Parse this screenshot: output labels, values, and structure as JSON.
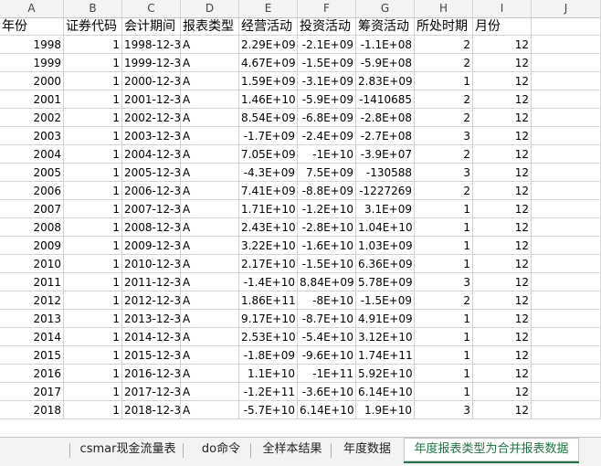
{
  "columns": [
    "A",
    "B",
    "C",
    "D",
    "E",
    "F",
    "G",
    "H",
    "I",
    "J"
  ],
  "headers": [
    "年份",
    "证券代码",
    "会计期间",
    "报表类型",
    "经营活动",
    "投资活动",
    "筹资活动",
    "所处时期",
    "月份",
    ""
  ],
  "rows": [
    [
      "1998",
      "1",
      "1998-12-3",
      "A",
      "2.29E+09",
      "-2.1E+09",
      "-1.1E+08",
      "2",
      "12"
    ],
    [
      "1999",
      "1",
      "1999-12-3",
      "A",
      "4.67E+09",
      "-1.5E+09",
      "-5.9E+08",
      "2",
      "12"
    ],
    [
      "2000",
      "1",
      "2000-12-3",
      "A",
      "1.59E+09",
      "-3.1E+09",
      "2.83E+09",
      "1",
      "12"
    ],
    [
      "2001",
      "1",
      "2001-12-3",
      "A",
      "1.46E+10",
      "-5.9E+09",
      "-1410685",
      "2",
      "12"
    ],
    [
      "2002",
      "1",
      "2002-12-3",
      "A",
      "8.54E+09",
      "-6.8E+09",
      "-2.8E+08",
      "2",
      "12"
    ],
    [
      "2003",
      "1",
      "2003-12-3",
      "A",
      "-1.7E+09",
      "-2.4E+09",
      "-2.7E+08",
      "3",
      "12"
    ],
    [
      "2004",
      "1",
      "2004-12-3",
      "A",
      "7.05E+09",
      "-1E+10",
      "-3.9E+07",
      "2",
      "12"
    ],
    [
      "2005",
      "1",
      "2005-12-3",
      "A",
      "-4.3E+09",
      "7.5E+09",
      "-130588",
      "3",
      "12"
    ],
    [
      "2006",
      "1",
      "2006-12-3",
      "A",
      "7.41E+09",
      "-8.8E+09",
      "-1227269",
      "2",
      "12"
    ],
    [
      "2007",
      "1",
      "2007-12-3",
      "A",
      "1.71E+10",
      "-1.2E+10",
      "3.1E+09",
      "1",
      "12"
    ],
    [
      "2008",
      "1",
      "2008-12-3",
      "A",
      "2.43E+10",
      "-2.8E+10",
      "1.04E+10",
      "1",
      "12"
    ],
    [
      "2009",
      "1",
      "2009-12-3",
      "A",
      "3.22E+10",
      "-1.6E+10",
      "1.03E+09",
      "1",
      "12"
    ],
    [
      "2010",
      "1",
      "2010-12-3",
      "A",
      "2.17E+10",
      "-1.5E+10",
      "6.36E+09",
      "1",
      "12"
    ],
    [
      "2011",
      "1",
      "2011-12-3",
      "A",
      "-1.4E+10",
      "8.84E+09",
      "5.78E+09",
      "3",
      "12"
    ],
    [
      "2012",
      "1",
      "2012-12-3",
      "A",
      "1.86E+11",
      "-8E+10",
      "-1.5E+09",
      "2",
      "12"
    ],
    [
      "2013",
      "1",
      "2013-12-3",
      "A",
      "9.17E+10",
      "-8.7E+10",
      "4.91E+09",
      "1",
      "12"
    ],
    [
      "2014",
      "1",
      "2014-12-3",
      "A",
      "2.53E+10",
      "-5.4E+10",
      "3.12E+10",
      "1",
      "12"
    ],
    [
      "2015",
      "1",
      "2015-12-3",
      "A",
      "-1.8E+09",
      "-9.6E+10",
      "1.74E+11",
      "1",
      "12"
    ],
    [
      "2016",
      "1",
      "2016-12-3",
      "A",
      "1.1E+10",
      "-1E+11",
      "5.92E+10",
      "1",
      "12"
    ],
    [
      "2017",
      "1",
      "2017-12-3",
      "A",
      "-1.2E+11",
      "-3.6E+10",
      "6.14E+10",
      "1",
      "12"
    ],
    [
      "2018",
      "1",
      "2018-12-3",
      "A",
      "-5.7E+10",
      "6.14E+10",
      "1.9E+10",
      "3",
      "12"
    ]
  ],
  "tabs": [
    "csmar现金流量表",
    "do命令",
    "全样本结果",
    "年度数据",
    "年度报表类型为合并报表数据"
  ],
  "active_tab": 4
}
